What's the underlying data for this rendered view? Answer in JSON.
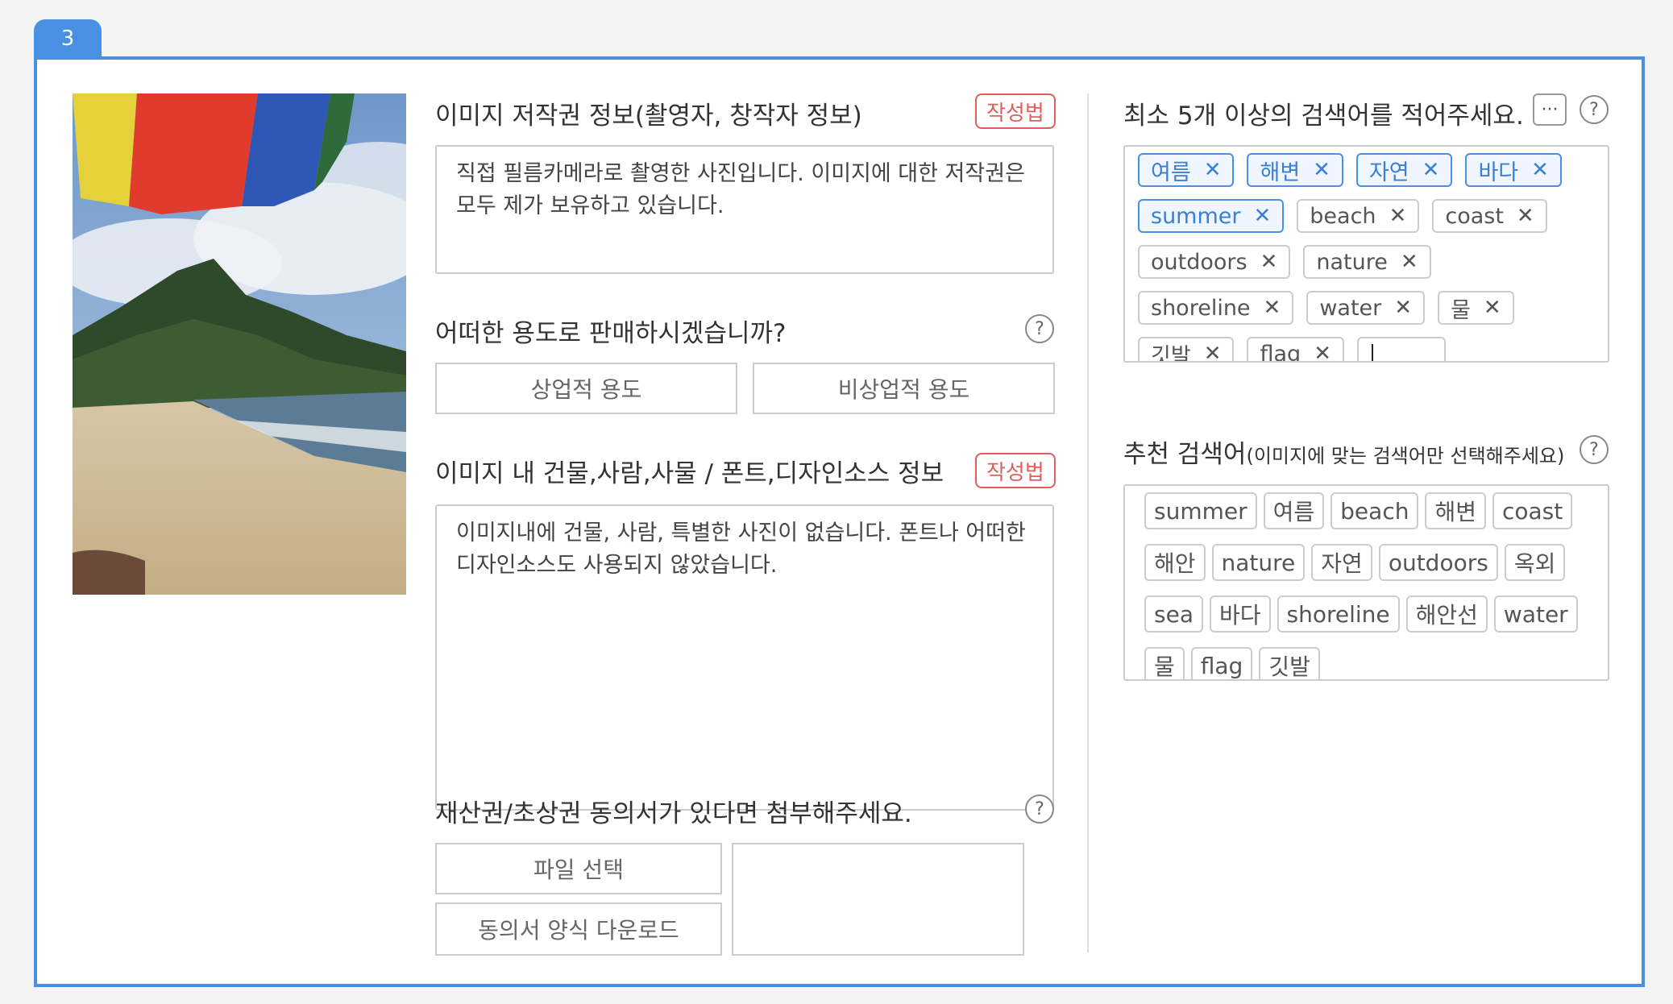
{
  "step_number": "3",
  "copyright": {
    "label": "이미지 저작권 정보(촬영자, 창작자 정보)",
    "guide_label": "작성법",
    "text": "직접 필름카메라로 촬영한 사진입니다. 이미지에 대한 저작권은\n모두 제가 보유하고 있습니다."
  },
  "usage": {
    "label": "어떠한 용도로 판매하시겠습니까?",
    "help": "?",
    "options": [
      "상업적 용도",
      "비상업적 용도"
    ]
  },
  "assets": {
    "label": "이미지 내 건물,사람,사물 / 폰트,디자인소스 정보",
    "guide_label": "작성법",
    "text": "이미지내에 건물, 사람, 특별한 사진이 없습니다. 폰트나 어떠한\n디자인소스도 사용되지 않았습니다."
  },
  "consent": {
    "label": "재산권/초상권 동의서가 있다면 첨부해주세요.",
    "help": "?",
    "file_button": "파일 선택",
    "download_button": "동의서 양식 다운로드"
  },
  "keywords": {
    "label": "최소 5개 이상의 검색어를 적어주세요.",
    "more": "···",
    "help": "?",
    "remove_symbol": "✕",
    "tags": [
      {
        "text": "여름",
        "selected": true
      },
      {
        "text": "해변",
        "selected": true
      },
      {
        "text": "자연",
        "selected": true
      },
      {
        "text": "바다",
        "selected": true
      },
      {
        "text": "summer",
        "selected": true
      },
      {
        "text": "beach",
        "selected": false
      },
      {
        "text": "coast",
        "selected": false
      },
      {
        "text": "outdoors",
        "selected": false
      },
      {
        "text": "nature",
        "selected": false
      },
      {
        "text": "shoreline",
        "selected": false
      },
      {
        "text": "water",
        "selected": false
      },
      {
        "text": "물",
        "selected": false
      },
      {
        "text": "깃발",
        "selected": false
      },
      {
        "text": "flag",
        "selected": false
      }
    ],
    "input_value": ""
  },
  "recommended": {
    "label": "추천 검색어",
    "sublabel": "(이미지에 맞는 검색어만 선택해주세요)",
    "help": "?",
    "chips": [
      "summer",
      "여름",
      "beach",
      "해변",
      "coast",
      "해안",
      "nature",
      "자연",
      "outdoors",
      "옥외",
      "sea",
      "바다",
      "shoreline",
      "해안선",
      "water",
      "물",
      "flag",
      "깃발"
    ]
  }
}
